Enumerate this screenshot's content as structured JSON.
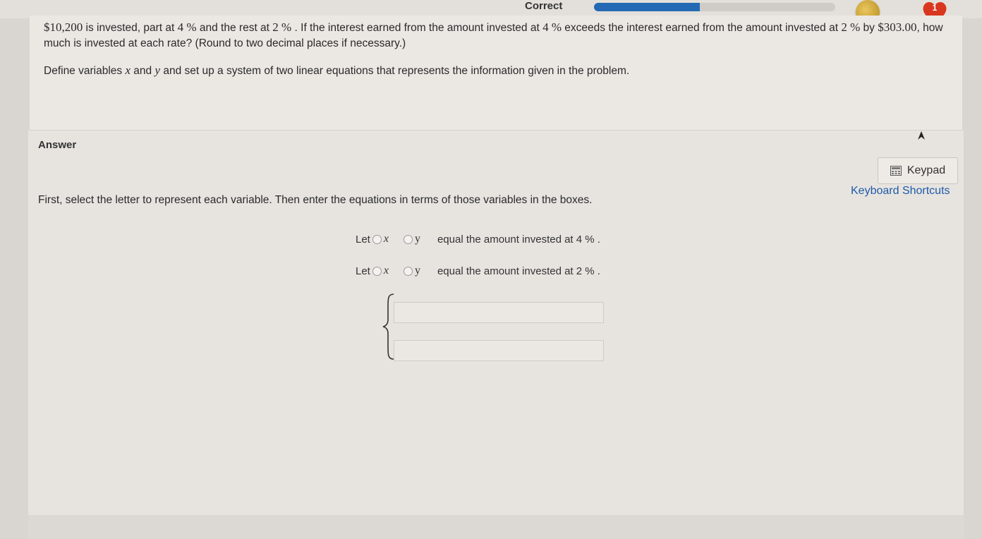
{
  "header": {
    "status": "Correct",
    "progress_fraction": 0.44,
    "hearts_count": "1",
    "colors": {
      "progress": "#2369b3",
      "heart": "#d9361f",
      "coin": "#c9a23a"
    }
  },
  "question": {
    "line_parts": {
      "amount": "$10,200",
      "t1": " is invested, part at ",
      "r1": "4 %",
      "t2": " and the rest at ",
      "r2": "2 %",
      "t3": " . If the interest earned from the amount invested at ",
      "r3": "4 %",
      "t4": " exceeds the interest earned from the amount invested at ",
      "r4": "2 %",
      "t5": " by ",
      "amount2": "$303.00",
      "t6": ", how much is invested at each rate? (Round to two decimal places if necessary.)"
    },
    "define": {
      "prefix": "Define variables ",
      "var_x": "x",
      "and": " and ",
      "var_y": "y",
      "suffix": " and set up a system of two linear equations that represents the information given in the problem."
    }
  },
  "answer": {
    "heading": "Answer",
    "keypad_label": "Keypad",
    "shortcuts_label": "Keyboard Shortcuts",
    "instructions": "First, select the letter to represent each variable. Then enter the equations in terms of those variables in the boxes.",
    "variable_rows": [
      {
        "let": "Let",
        "opt_x": "x",
        "opt_y": "y",
        "desc": "equal the amount invested at 4 % ."
      },
      {
        "let": "Let",
        "opt_x": "x",
        "opt_y": "y",
        "desc": "equal the amount invested at 2 % ."
      }
    ],
    "equation_1": "",
    "equation_2": ""
  }
}
